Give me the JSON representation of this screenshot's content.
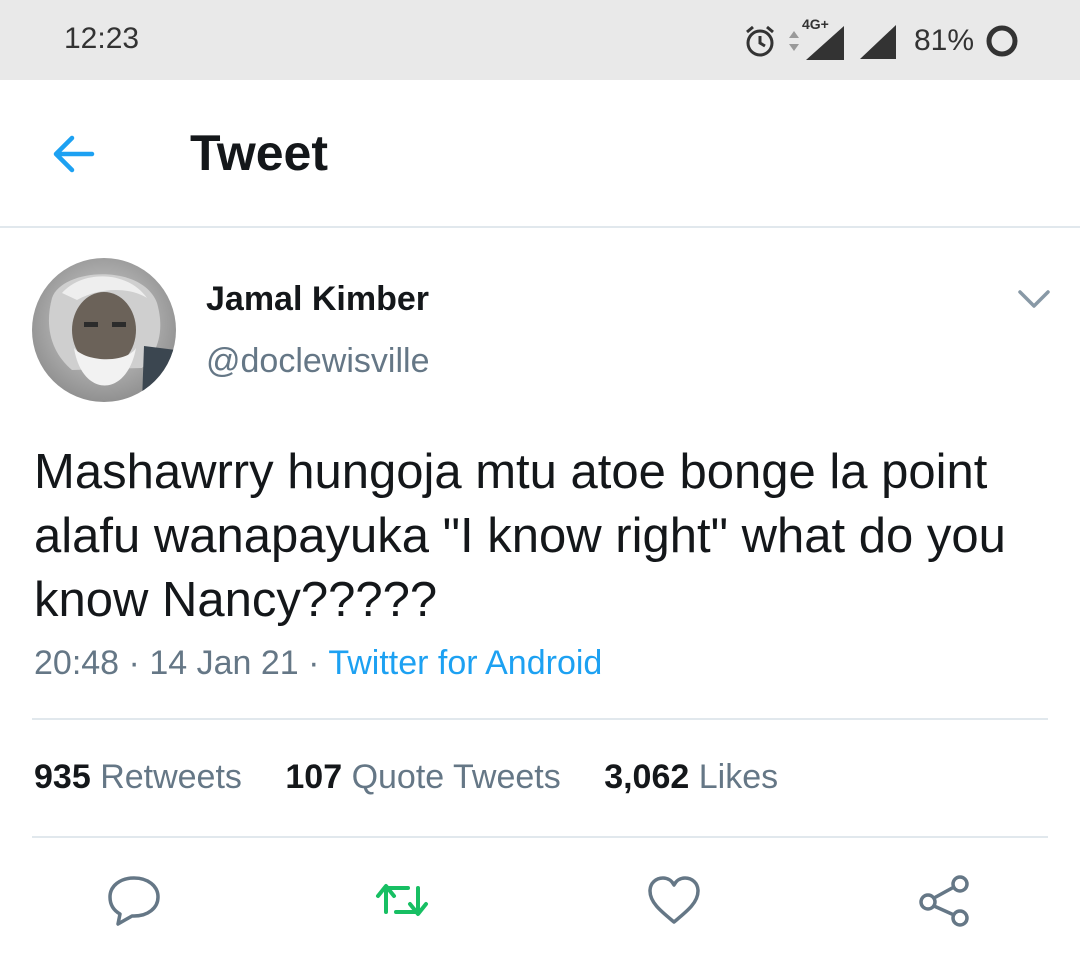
{
  "status_bar": {
    "time": "12:23",
    "network_label": "4G+",
    "battery": "81%",
    "icons": [
      "alarm-icon",
      "data-arrows-icon",
      "signal-icon",
      "signal-icon",
      "battery-circle-icon"
    ]
  },
  "appbar": {
    "back_icon": "arrow-left-icon",
    "title": "Tweet"
  },
  "tweet": {
    "author_name": "Jamal Kimber",
    "author_handle": "@doclewisville",
    "text": "Mashawrry hungoja mtu atoe bonge la point alafu wanapayuka \"I know right\" what do you know Nancy?????",
    "time": "20:48",
    "separator": "·",
    "date": "14 Jan 21",
    "source": "Twitter for Android"
  },
  "stats": {
    "retweets_count": "935",
    "retweets_label": "Retweets",
    "quotes_count": "107",
    "quotes_label": "Quote Tweets",
    "likes_count": "3,062",
    "likes_label": "Likes"
  },
  "actions": {
    "icons": [
      "reply-icon",
      "retweet-icon",
      "like-icon",
      "share-icon"
    ]
  },
  "colors": {
    "accent": "#1da1f2",
    "retweet": "#17bf63",
    "secondary_text": "#657786",
    "divider": "#e1e8ed",
    "status_bar_bg": "#e9e9e9"
  }
}
